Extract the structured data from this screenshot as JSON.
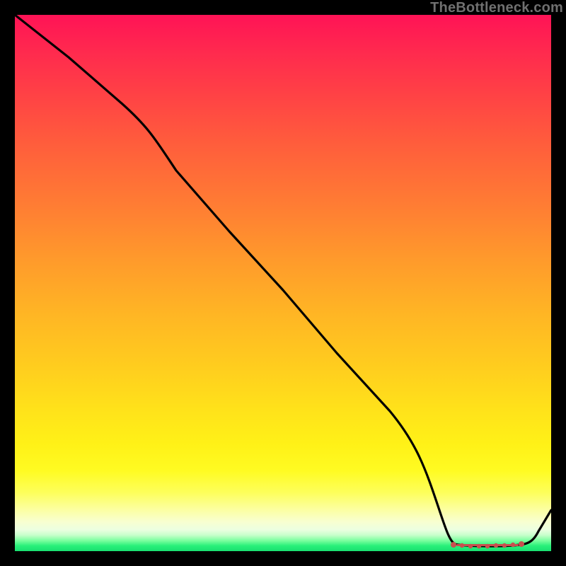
{
  "watermark": "TheBottleneck.com",
  "chart_data": {
    "type": "line",
    "title": "",
    "xlabel": "",
    "ylabel": "",
    "xlim": [
      0,
      100
    ],
    "ylim": [
      0,
      100
    ],
    "x": [
      0,
      10,
      20,
      30,
      40,
      50,
      60,
      70,
      78,
      80,
      82,
      84,
      86,
      88,
      90,
      92,
      94,
      96,
      100
    ],
    "values": [
      100,
      92,
      83,
      75,
      63,
      50,
      37,
      24,
      14,
      5,
      2,
      1,
      1,
      1,
      1,
      1,
      1,
      2,
      8
    ],
    "series_name": "curve",
    "background_gradient": {
      "top": "#ff1356",
      "mid": "#ffe31a",
      "bottom": "#18e070"
    },
    "markers": {
      "x": [
        80,
        82,
        84,
        86,
        88,
        90,
        92,
        94
      ],
      "y": [
        1,
        1,
        1,
        1,
        1,
        1,
        1,
        1
      ],
      "color": "#d34a4a"
    }
  }
}
